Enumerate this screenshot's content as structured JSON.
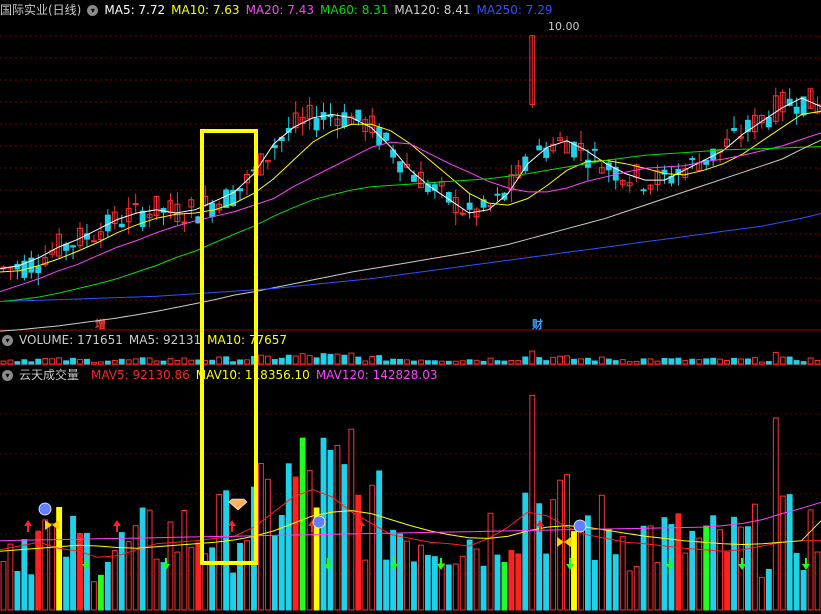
{
  "header_main": {
    "title": "国际实业(日线)",
    "ma": [
      {
        "label": "MA5: 7.72",
        "color": "#ffffff"
      },
      {
        "label": "MA10: 7.63",
        "color": "#ffff00"
      },
      {
        "label": "MA20: 7.43",
        "color": "#ff40ff"
      },
      {
        "label": "MA60: 8.31",
        "color": "#00e000"
      },
      {
        "label": "MA120: 8.41",
        "color": "#cccccc"
      },
      {
        "label": "MA250: 7.29",
        "color": "#3050ff"
      }
    ]
  },
  "header_vol": {
    "items": [
      {
        "label": "VOLUME: 171651",
        "color": "#cccccc"
      },
      {
        "label": "MA5: 92131",
        "color": "#cccccc"
      },
      {
        "label": "MA10: 77657",
        "color": "#ffff00"
      }
    ]
  },
  "header_ind": {
    "title": "云天成交量",
    "items": [
      {
        "label": "MAV5: 92130.86",
        "color": "#ff2020"
      },
      {
        "label": "MAV10: 118356.10",
        "color": "#ffff00"
      },
      {
        "label": "MAV120: 142828.03",
        "color": "#ff40ff"
      }
    ]
  },
  "markers": {
    "zeng": "增",
    "cai": "财",
    "high_label": "10.00"
  },
  "colors": {
    "up": "#ff3030",
    "down": "#20d0e8",
    "ma5": "#ffffff",
    "ma10": "#ffff00",
    "ma20": "#ff40ff",
    "ma60": "#00e000",
    "ma120": "#cccccc",
    "ma250": "#3050ff",
    "highlight": "#ffff00"
  },
  "chart_data": {
    "type": "candlestick",
    "ylim": [
      5.7,
      10.3
    ],
    "price_series": [
      {
        "name": "MA5",
        "values": [
          6.45,
          6.5,
          6.62,
          6.78,
          6.9,
          7.05,
          7.2,
          7.3,
          7.35,
          7.3,
          7.35,
          7.48,
          7.62,
          7.9,
          8.35,
          8.6,
          8.75,
          8.8,
          8.75,
          8.6,
          8.3,
          7.95,
          7.7,
          7.5,
          7.3,
          7.35,
          7.6,
          8.05,
          8.3,
          8.4,
          8.25,
          8.05,
          7.9,
          7.8,
          7.8,
          7.95,
          8.1,
          8.25,
          8.5,
          8.7,
          8.9,
          9.05,
          8.92
        ]
      },
      {
        "name": "MA10",
        "values": [
          6.4,
          6.42,
          6.5,
          6.6,
          6.72,
          6.85,
          7.0,
          7.12,
          7.22,
          7.28,
          7.3,
          7.35,
          7.45,
          7.6,
          7.82,
          8.1,
          8.38,
          8.55,
          8.65,
          8.65,
          8.55,
          8.35,
          8.1,
          7.85,
          7.6,
          7.45,
          7.42,
          7.52,
          7.72,
          7.95,
          8.08,
          8.1,
          8.05,
          7.98,
          7.9,
          7.88,
          7.95,
          8.05,
          8.2,
          8.4,
          8.6,
          8.8,
          8.85
        ]
      },
      {
        "name": "MA20",
        "values": [
          6.1,
          6.2,
          6.3,
          6.42,
          6.52,
          6.65,
          6.78,
          6.88,
          7.0,
          7.1,
          7.18,
          7.25,
          7.32,
          7.42,
          7.52,
          7.7,
          7.85,
          8.0,
          8.15,
          8.3,
          8.38,
          8.35,
          8.2,
          8.05,
          7.92,
          7.78,
          7.68,
          7.62,
          7.62,
          7.68,
          7.78,
          7.85,
          7.92,
          7.98,
          8.0,
          8.02,
          8.08,
          8.12,
          8.18,
          8.25,
          8.32,
          8.42,
          8.52
        ]
      },
      {
        "name": "MA60",
        "values": [
          5.95,
          5.98,
          6.02,
          6.08,
          6.15,
          6.22,
          6.3,
          6.4,
          6.5,
          6.62,
          6.72,
          6.85,
          6.98,
          7.1,
          7.25,
          7.38,
          7.5,
          7.58,
          7.65,
          7.7,
          7.72,
          7.74,
          7.76,
          7.78,
          7.8,
          7.82,
          7.86,
          7.9,
          7.95,
          8.0,
          8.05,
          8.1,
          8.14,
          8.18,
          8.2,
          8.22,
          8.24,
          8.26,
          8.27,
          8.28,
          8.29,
          8.3,
          8.31
        ]
      },
      {
        "name": "MA120",
        "values": [
          5.5,
          5.52,
          5.55,
          5.58,
          5.62,
          5.66,
          5.7,
          5.75,
          5.8,
          5.86,
          5.92,
          5.98,
          6.05,
          6.1,
          6.16,
          6.22,
          6.28,
          6.34,
          6.4,
          6.45,
          6.5,
          6.55,
          6.6,
          6.65,
          6.7,
          6.76,
          6.82,
          6.9,
          6.98,
          7.06,
          7.14,
          7.22,
          7.32,
          7.42,
          7.52,
          7.62,
          7.72,
          7.82,
          7.92,
          8.02,
          8.12,
          8.27,
          8.41
        ]
      },
      {
        "name": "MA250",
        "values": [
          5.95,
          5.96,
          5.97,
          5.98,
          5.99,
          6.0,
          6.01,
          6.02,
          6.03,
          6.05,
          6.07,
          6.09,
          6.11,
          6.13,
          6.15,
          6.18,
          6.21,
          6.24,
          6.27,
          6.3,
          6.34,
          6.38,
          6.42,
          6.46,
          6.5,
          6.54,
          6.58,
          6.62,
          6.66,
          6.7,
          6.74,
          6.78,
          6.82,
          6.86,
          6.9,
          6.94,
          6.98,
          7.02,
          7.06,
          7.1,
          7.16,
          7.22,
          7.29
        ]
      }
    ],
    "price_high_marker": 10.0,
    "highlight_range": [
      17,
      21
    ],
    "volume_max": 300000,
    "volume_upper_panel_max": 1500000,
    "mav_series": [
      {
        "name": "MAV5",
        "values": [
          80000,
          85000,
          90000,
          82000,
          78000,
          70000,
          72000,
          80000,
          88000,
          90000,
          92000,
          95000,
          98000,
          110000,
          130000,
          150000,
          160000,
          150000,
          130000,
          115000,
          100000,
          95000,
          90000,
          88000,
          85000,
          95000,
          110000,
          130000,
          125000,
          110000,
          100000,
          95000,
          90000,
          88000,
          85000,
          82000,
          80000,
          78000,
          80000,
          85000,
          90000,
          92000,
          92131
        ]
      },
      {
        "name": "MAV10",
        "values": [
          78000,
          80000,
          82000,
          84000,
          86000,
          85000,
          83000,
          82000,
          84000,
          86000,
          88000,
          90000,
          93000,
          98000,
          105000,
          115000,
          125000,
          130000,
          132000,
          128000,
          120000,
          112000,
          105000,
          100000,
          96000,
          95000,
          98000,
          105000,
          110000,
          112000,
          110000,
          106000,
          102000,
          98000,
          95000,
          92000,
          90000,
          88000,
          87000,
          88000,
          90000,
          92000,
          118356
        ]
      },
      {
        "name": "MAV120",
        "values": [
          92000,
          92500,
          93000,
          93500,
          94000,
          94500,
          95000,
          95500,
          96000,
          96500,
          97000,
          97500,
          98000,
          98500,
          99000,
          99500,
          100000,
          100500,
          101000,
          101500,
          102000,
          102500,
          103000,
          103500,
          104000,
          104500,
          105000,
          105500,
          106000,
          106500,
          107000,
          107500,
          108000,
          108500,
          109000,
          109500,
          110000,
          112000,
          115000,
          120000,
          128000,
          135000,
          142828
        ]
      }
    ]
  }
}
